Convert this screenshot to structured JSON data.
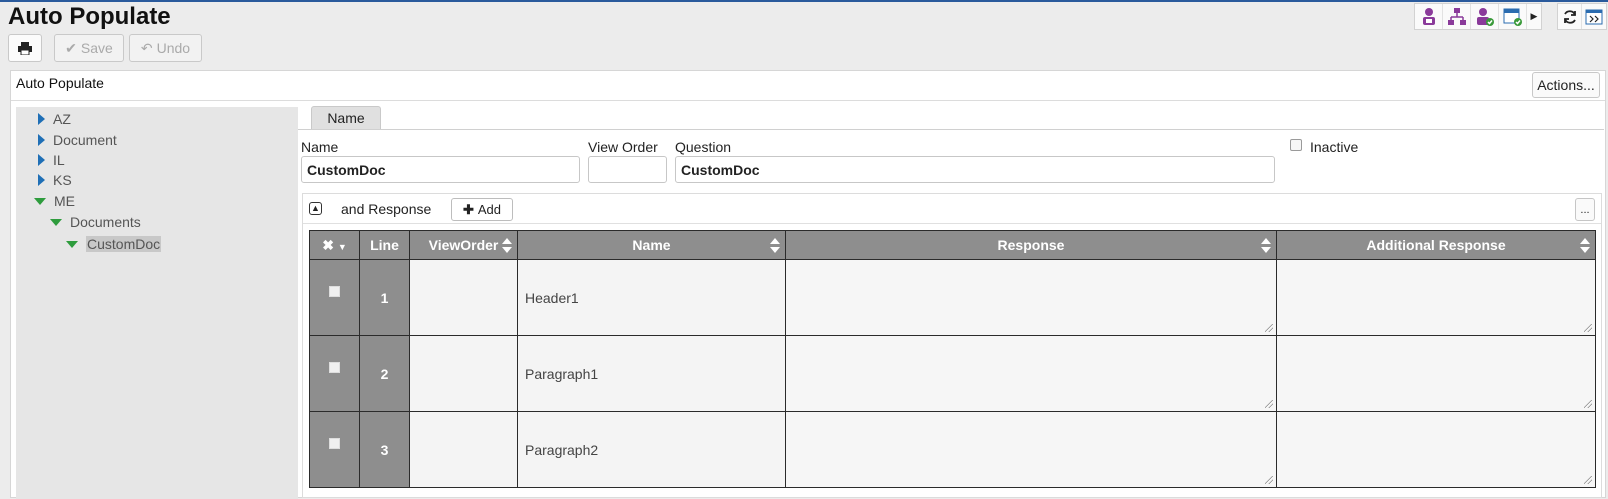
{
  "page": {
    "title": "Auto Populate"
  },
  "toolbar": {
    "save_label": "Save",
    "undo_label": "Undo"
  },
  "panel": {
    "title": "Auto Populate",
    "actions_label": "Actions..."
  },
  "tree": {
    "items": [
      {
        "label": "AZ",
        "state": "collapsed"
      },
      {
        "label": "Document",
        "state": "collapsed"
      },
      {
        "label": "IL",
        "state": "collapsed"
      },
      {
        "label": "KS",
        "state": "collapsed"
      },
      {
        "label": "ME",
        "state": "expanded"
      },
      {
        "label": "Documents",
        "state": "expanded"
      },
      {
        "label": "CustomDoc",
        "state": "expanded",
        "selected": true
      }
    ]
  },
  "tab": {
    "label": "Name"
  },
  "form": {
    "name_label": "Name",
    "name_value": "CustomDoc",
    "view_order_label": "View Order",
    "view_order_value": "",
    "question_label": "Question",
    "question_value": "CustomDoc",
    "inactive_label": "Inactive",
    "inactive_checked": false
  },
  "grid": {
    "title": "and Response",
    "add_label": "Add",
    "more_label": "...",
    "columns": [
      "Line",
      "ViewOrder",
      "Name",
      "Response",
      "Additional Response"
    ],
    "rows": [
      {
        "line": "1",
        "view_order": "",
        "name": "Header1",
        "response": "",
        "additional_response": ""
      },
      {
        "line": "2",
        "view_order": "",
        "name": "Paragraph1",
        "response": "",
        "additional_response": ""
      },
      {
        "line": "3",
        "view_order": "",
        "name": "Paragraph2",
        "response": "",
        "additional_response": ""
      }
    ]
  },
  "colors": {
    "header_gray": "#8e8e8e",
    "tree_expand_blue": "#1f6fb6",
    "tree_expanded_green": "#2e9c3d",
    "top_accent": "#2a5a9c"
  }
}
